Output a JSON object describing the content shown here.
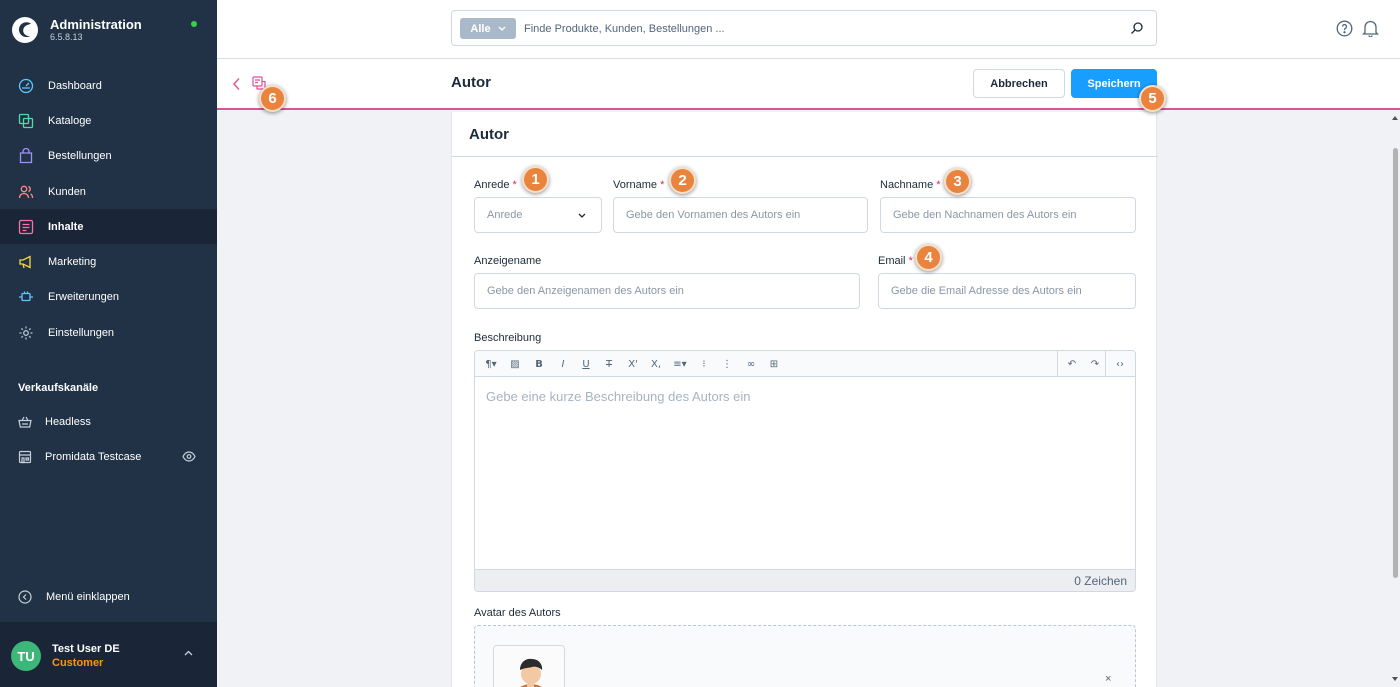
{
  "app": {
    "title": "Administration",
    "version": "6.5.8.13"
  },
  "nav": {
    "items": [
      {
        "label": "Dashboard",
        "icon": "dashboard-icon"
      },
      {
        "label": "Kataloge",
        "icon": "catalog-icon"
      },
      {
        "label": "Bestellungen",
        "icon": "orders-icon"
      },
      {
        "label": "Kunden",
        "icon": "customers-icon"
      },
      {
        "label": "Inhalte",
        "icon": "content-icon",
        "active": true
      },
      {
        "label": "Marketing",
        "icon": "megaphone-icon"
      },
      {
        "label": "Erweiterungen",
        "icon": "plug-icon"
      },
      {
        "label": "Einstellungen",
        "icon": "gear-icon"
      }
    ],
    "sales_channels_heading": "Verkaufskanäle",
    "sales_channels": [
      {
        "label": "Headless",
        "icon": "basket-icon"
      },
      {
        "label": "Promidata Testcase",
        "icon": "storefront-icon",
        "has_eye": true
      }
    ],
    "collapse_label": "Menü einklappen"
  },
  "user": {
    "initials": "TU",
    "name": "Test User DE",
    "role": "Customer"
  },
  "search": {
    "type_label": "Alle",
    "placeholder": "Finde Produkte, Kunden, Bestellungen ..."
  },
  "header": {
    "title": "Autor",
    "cancel_label": "Abbrechen",
    "save_label": "Speichern"
  },
  "card": {
    "title": "Autor",
    "salutation": {
      "label": "Anrede",
      "required": "*",
      "placeholder": "Anrede"
    },
    "first_name": {
      "label": "Vorname",
      "required": "*",
      "placeholder": "Gebe den Vornamen des Autors ein"
    },
    "last_name": {
      "label": "Nachname",
      "required": "*",
      "placeholder": "Gebe den Nachnamen des Autors ein"
    },
    "display_name": {
      "label": "Anzeigename",
      "placeholder": "Gebe den Anzeigenamen des Autors ein"
    },
    "email": {
      "label": "Email",
      "required": "*",
      "placeholder": "Gebe die Email Adresse des Autors ein"
    },
    "description": {
      "label": "Beschreibung",
      "placeholder": "Gebe eine kurze Beschreibung des Autors ein",
      "char_count": "0 Zeichen"
    },
    "avatar": {
      "label": "Avatar des Autors",
      "remove_symbol": "×"
    }
  },
  "badges": [
    "1",
    "2",
    "3",
    "4",
    "5",
    "6"
  ],
  "colors": {
    "sidebar": "#213247",
    "primary": "#189eff",
    "accent_line": "#e05295",
    "badge": "#e8843e",
    "required": "#de294c",
    "role": "#ff9800"
  }
}
